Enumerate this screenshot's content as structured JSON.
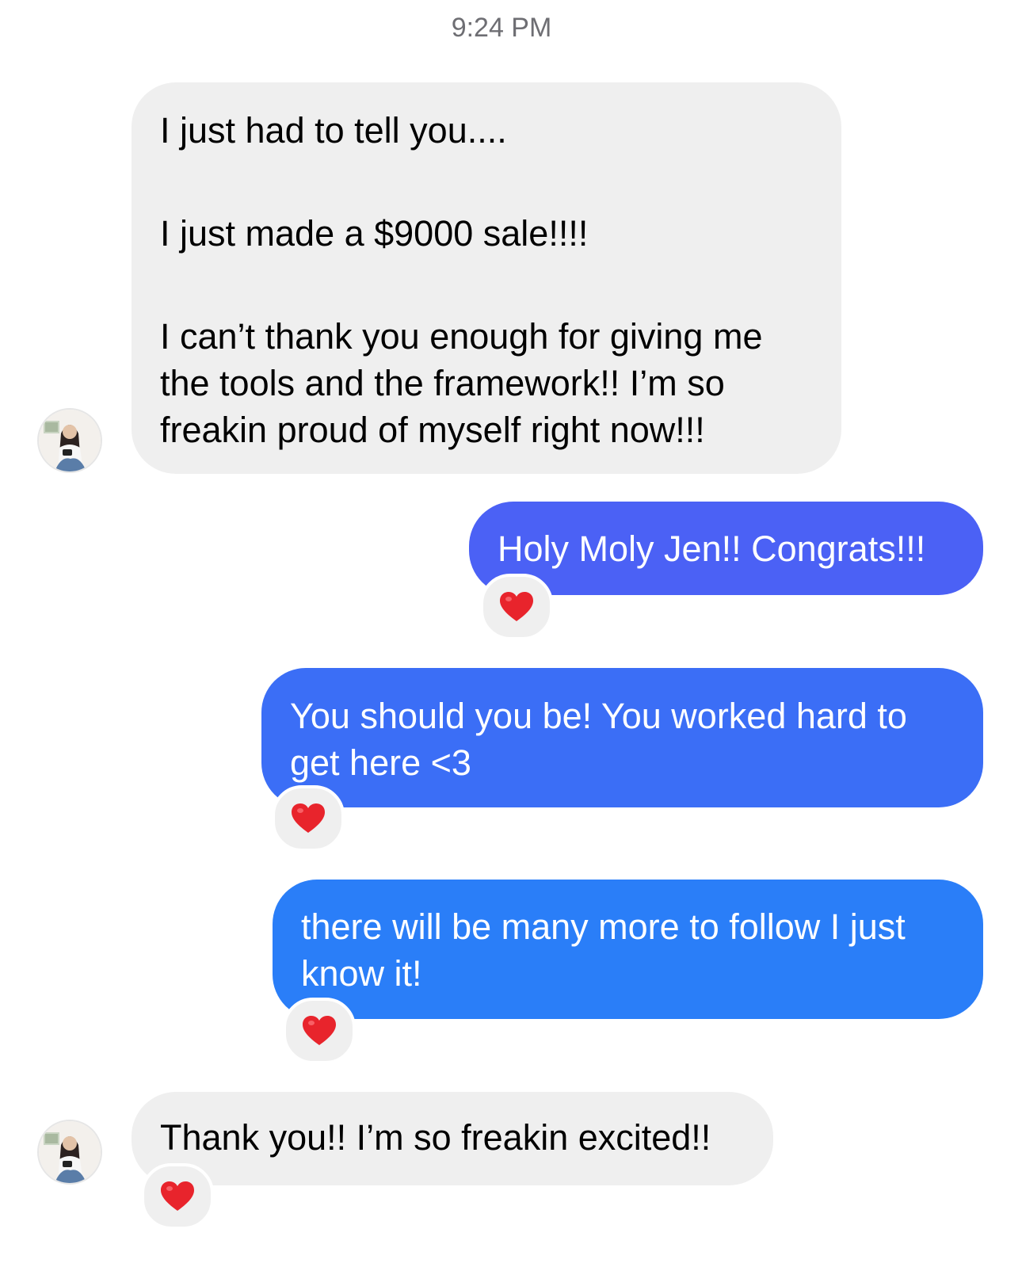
{
  "timestamp": "9:24 PM",
  "messages": [
    {
      "sender": "them",
      "paragraphs": [
        "I just had to tell you....",
        "I just made a $9000 sale!!!!",
        "I can’t thank you enough for giving me the tools and the framework!! I’m so freakin proud of myself right now!!!"
      ]
    },
    {
      "sender": "me",
      "text": "Holy Moly Jen!! Congrats!!!",
      "reaction": "heart-icon"
    },
    {
      "sender": "me",
      "text": "You should you be! You worked hard to get here <3",
      "reaction": "heart-icon"
    },
    {
      "sender": "me",
      "text": "there will be many more to follow I just know it!",
      "reaction": "heart-icon"
    },
    {
      "sender": "them",
      "text": "Thank you!! I’m so freakin excited!!",
      "reaction": "heart-icon"
    }
  ],
  "colors": {
    "incoming_bubble": "#efefef",
    "outgoing_gradient": [
      "#4b61f5",
      "#3b6ef6",
      "#2a7ef8"
    ],
    "reaction_heart": "#e8242c",
    "timestamp_text": "#6e6e73"
  }
}
